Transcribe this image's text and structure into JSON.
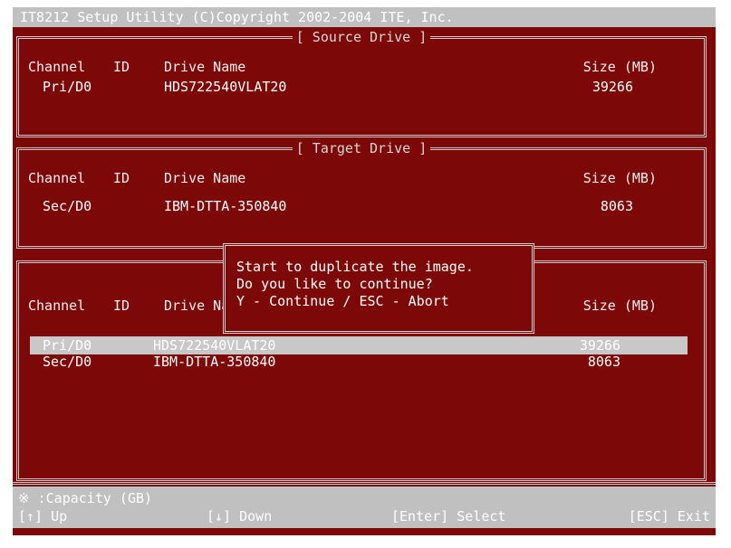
{
  "title": "IT8212 Setup Utility (C)Copyright 2002-2004 ITE, Inc.",
  "source_panel": {
    "title": "[ Source Drive ]",
    "columns": {
      "channel": "Channel",
      "id": "ID",
      "name": "Drive Name",
      "size": "Size (MB)"
    },
    "drive": {
      "channel": "Pri/D0",
      "name": "HDS722540VLAT20",
      "size": "39266"
    }
  },
  "target_panel": {
    "title": "[ Target Drive ]",
    "columns": {
      "channel": "Channel",
      "id": "ID",
      "name": "Drive Name",
      "size": "Size (MB)"
    },
    "drive": {
      "channel": "Sec/D0",
      "name": "IBM-DTTA-350840",
      "size": "8063"
    }
  },
  "list_panel": {
    "columns": {
      "channel": "Channel",
      "id": "ID",
      "name": "Drive Name",
      "size": "Size (MB)"
    },
    "rows": [
      {
        "channel": "Pri/D0",
        "name": "HDS722540VLAT20",
        "size": "39266",
        "selected": true
      },
      {
        "channel": "Sec/D0",
        "name": "IBM-DTTA-350840",
        "size": "8063",
        "selected": false
      }
    ]
  },
  "dialog": {
    "line1": "Start to duplicate the image.",
    "line2": "Do you like to continue?",
    "line3": "Y - Continue / ESC - Abort"
  },
  "footer": {
    "note": "※ :Capacity (GB)",
    "up": "[↑] Up",
    "down": "[↓] Down",
    "select": "[Enter] Select",
    "exit": "[ESC] Exit"
  },
  "colors": {
    "background": "#7d0808",
    "bar": "#c0c0c0",
    "text": "#ffffff"
  }
}
